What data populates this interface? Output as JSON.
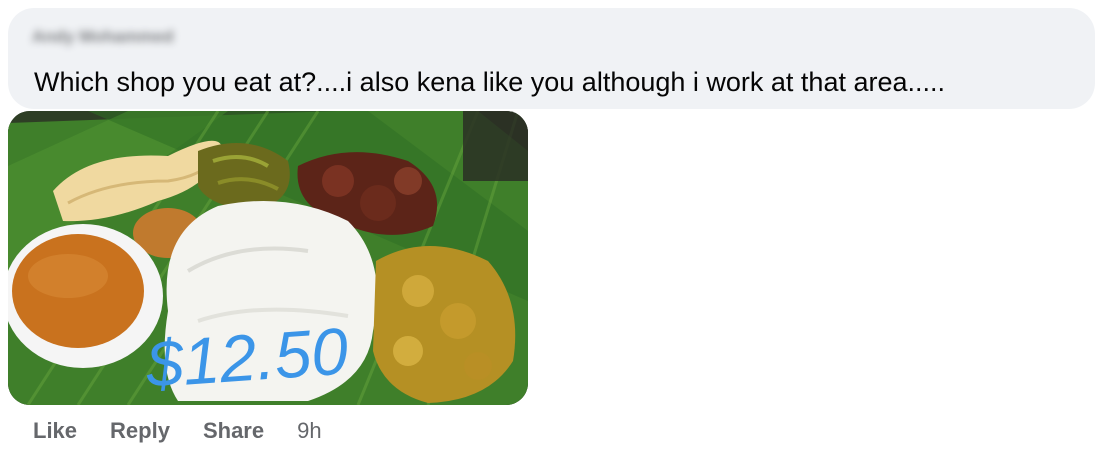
{
  "comment": {
    "author": "Andy Mohammed",
    "text": "Which shop you eat at?....i also kena like you although i work at that area.....",
    "photo_price_text": "$12.50"
  },
  "actions": {
    "like": "Like",
    "reply": "Reply",
    "share": "Share",
    "time": "9h"
  },
  "colors": {
    "bubble": "#f0f2f5",
    "action_text": "#65676b",
    "price": "#3b95e8"
  }
}
